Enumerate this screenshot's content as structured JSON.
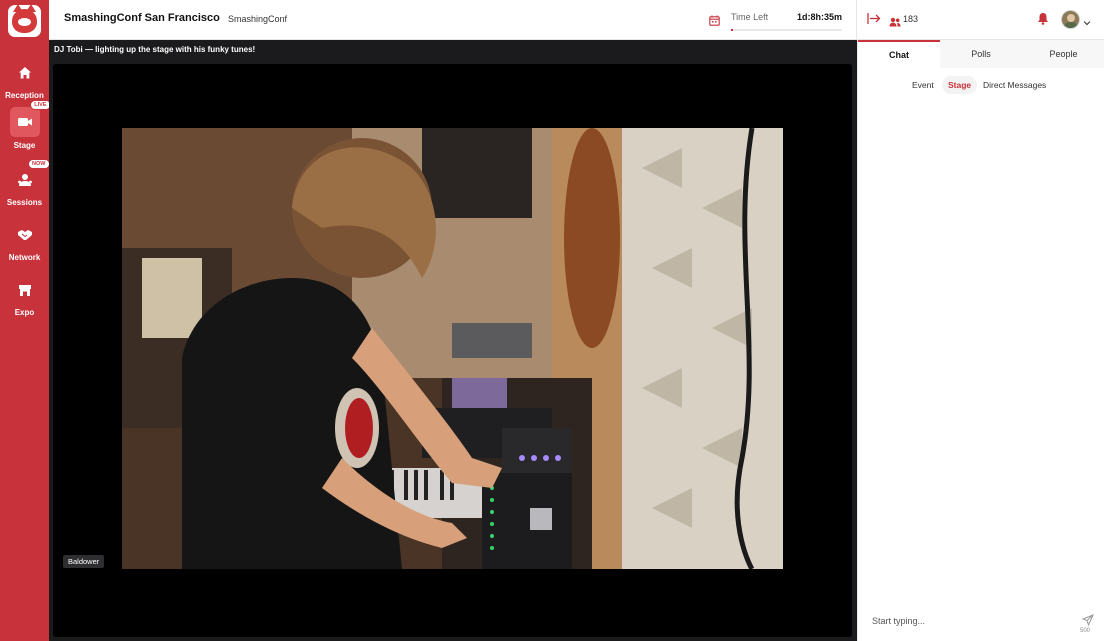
{
  "app": {
    "event_title": "SmashingConf San Francisco",
    "event_subtitle": "SmashingConf",
    "logo_icon": "cat-logo-icon"
  },
  "header": {
    "time_left_label": "Time Left",
    "time_left_value": "1d:8h:35m",
    "time_progress": 0.02,
    "attendee_count": "183",
    "accent_color": "#c8323a"
  },
  "sidebar": {
    "items": [
      {
        "label": "Reception",
        "icon": "home-icon",
        "badge": ""
      },
      {
        "label": "Stage",
        "icon": "camera-icon",
        "badge": "LIVE"
      },
      {
        "label": "Sessions",
        "icon": "sessions-icon",
        "badge": "NOW"
      },
      {
        "label": "Network",
        "icon": "handshake-icon",
        "badge": ""
      },
      {
        "label": "Expo",
        "icon": "booth-icon",
        "badge": ""
      }
    ]
  },
  "stage": {
    "title": "DJ Tobi — lighting up the stage with his funky tunes!",
    "speaker_tag": "Baldower"
  },
  "panel": {
    "tabs": [
      {
        "label": "Chat"
      },
      {
        "label": "Polls"
      },
      {
        "label": "People"
      }
    ],
    "subtabs": [
      {
        "label": "Event"
      },
      {
        "label": "Stage"
      },
      {
        "label": "Direct Messages"
      }
    ],
    "chat_placeholder": "Start typing...",
    "char_limit": "500"
  }
}
